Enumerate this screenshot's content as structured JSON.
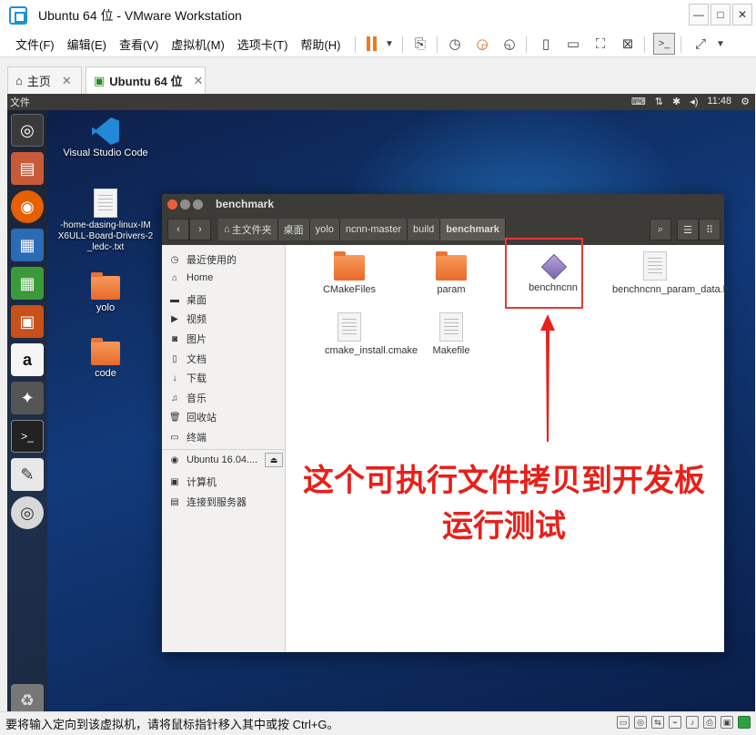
{
  "window": {
    "title": "Ubuntu 64 位 - VMware Workstation",
    "controls": {
      "minimize": "—",
      "maximize": "□",
      "close": "✕"
    }
  },
  "menubar": {
    "items": [
      "文件(F)",
      "编辑(E)",
      "查看(V)",
      "虚拟机(M)",
      "选项卡(T)",
      "帮助(H)"
    ]
  },
  "tabs": [
    {
      "label": "主页",
      "icon": "home-icon"
    },
    {
      "label": "Ubuntu 64 位",
      "icon": "vm-icon",
      "active": true
    }
  ],
  "ubuntu": {
    "topbar": {
      "menu_label": "文件",
      "clock": "11:48"
    }
  },
  "desktop": {
    "icons": [
      {
        "label": "Visual Studio Code",
        "icon": "vscode-icon"
      },
      {
        "label": "-home-dasing-linux-IMX6ULL-Board-Drivers-2_ledc-.txt",
        "icon": "text-file-icon"
      },
      {
        "label": "yolo",
        "icon": "folder-icon"
      },
      {
        "label": "code",
        "icon": "folder-icon"
      }
    ]
  },
  "nautilus": {
    "title": "benchmark",
    "breadcrumbs": [
      "主文件夹",
      "桌面",
      "yolo",
      "ncnn-master",
      "build",
      "benchmark"
    ],
    "sidebar": [
      {
        "label": "最近使用的",
        "icon": "clock-icon"
      },
      {
        "label": "Home",
        "icon": "home-icon"
      },
      {
        "label": "桌面",
        "icon": "desktop-icon"
      },
      {
        "label": "视频",
        "icon": "video-icon"
      },
      {
        "label": "图片",
        "icon": "camera-icon"
      },
      {
        "label": "文档",
        "icon": "document-icon"
      },
      {
        "label": "下载",
        "icon": "download-icon"
      },
      {
        "label": "音乐",
        "icon": "music-icon"
      },
      {
        "label": "回收站",
        "icon": "trash-icon"
      },
      {
        "label": "终端",
        "icon": "placeholder"
      }
    ],
    "sidebar_devices": [
      {
        "label": "Ubuntu 16.04....",
        "icon": "disc-icon"
      },
      {
        "label": "计算机",
        "icon": "computer-icon"
      },
      {
        "label": "连接到服务器",
        "icon": "server-icon"
      }
    ],
    "files": [
      {
        "name": "CMakeFiles",
        "type": "folder"
      },
      {
        "name": "param",
        "type": "folder"
      },
      {
        "name": "benchncnn",
        "type": "executable"
      },
      {
        "name": "benchncnn_param_data.h",
        "type": "header"
      },
      {
        "name": "cmake_install.cmake",
        "type": "text"
      },
      {
        "name": "Makefile",
        "type": "text"
      }
    ]
  },
  "annotation": {
    "line1": "这个可执行文件拷贝到开发板",
    "line2": "运行测试",
    "color": "#e8201a"
  },
  "statusbar": {
    "message": "要将输入定向到该虚拟机，请将鼠标指针移入其中或按 Ctrl+G。"
  }
}
